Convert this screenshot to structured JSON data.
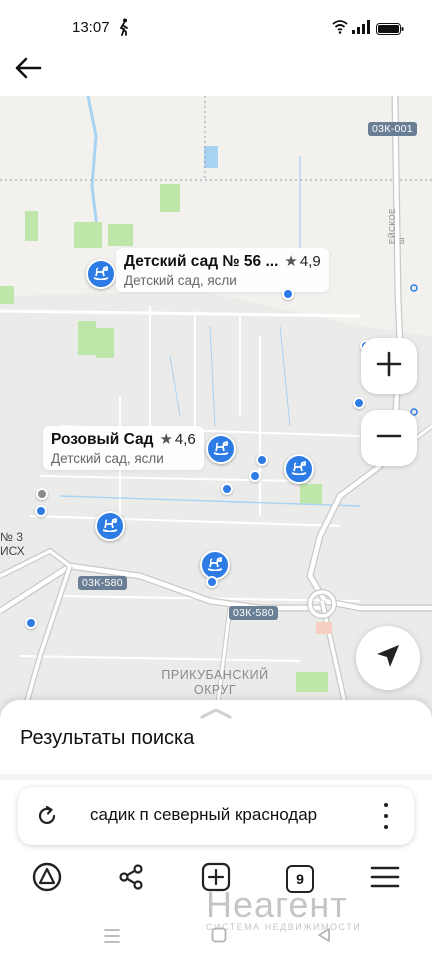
{
  "status_bar": {
    "time": "13:07",
    "icons": [
      "walk-icon",
      "wifi-icon",
      "signal-icon",
      "battery-icon"
    ]
  },
  "header": {
    "back_icon": "arrow-left-icon"
  },
  "map": {
    "places": [
      {
        "name": "Детский сад № 56 ...",
        "rating": "4,9",
        "category": "Детский сад, ясли"
      },
      {
        "name": "Розовый Сад",
        "rating": "4,6",
        "category": "Детский сад, ясли"
      }
    ],
    "road_badges": [
      "03К-001",
      "03К-580",
      "03К-580"
    ],
    "area_label_line1": "ПРИКУБАНСКИЙ",
    "area_label_line2": "ОКРУГ",
    "street_label": "ЕЙСКОЕ ш",
    "partial_label_line1": "№ 3",
    "partial_label_line2": "ИСХ",
    "pin_icon": "rocking-horse-icon",
    "marker_color": "#2d7be5",
    "controls": {
      "zoom_in_icon": "plus-icon",
      "zoom_out_icon": "minus-icon",
      "locate_icon": "navigation-arrow-icon"
    }
  },
  "sheet": {
    "title": "Результаты поиска",
    "handle_icon": "chevron-up-icon"
  },
  "search": {
    "query": "садик п северный краснодар",
    "refresh_icon": "refresh-icon",
    "more_icon": "more-vertical-icon"
  },
  "toolbar": {
    "alice_icon": "alice-icon",
    "share_icon": "share-icon",
    "new_tab_icon": "plus-square-icon",
    "tab_count": "9",
    "menu_icon": "hamburger-icon"
  },
  "watermark": {
    "main": "Неагент",
    "sub": "СИСТЕМА НЕДВИЖИМОСТИ"
  },
  "nav_bar": {
    "icons": [
      "recent-apps-icon",
      "home-icon",
      "back-triangle-icon"
    ]
  }
}
